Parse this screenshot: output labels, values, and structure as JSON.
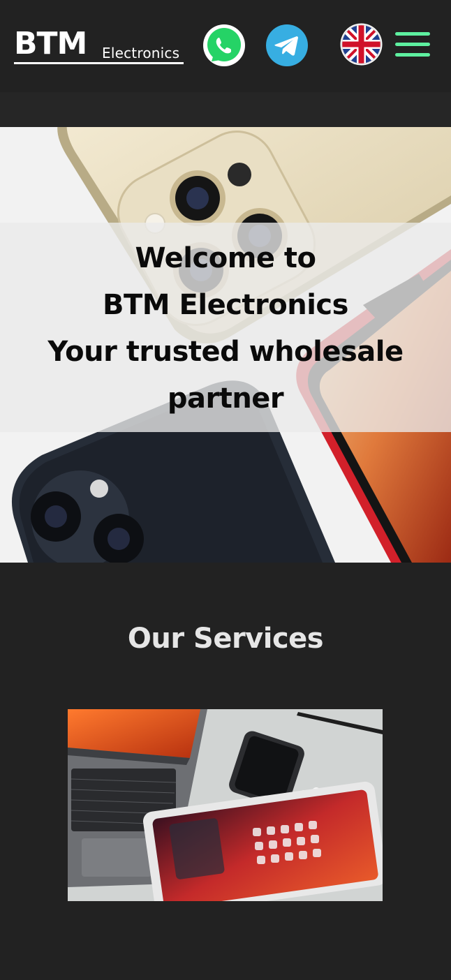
{
  "header": {
    "logo": {
      "mark": "BTM",
      "sub": "Electronics"
    },
    "whatsapp_icon": "whatsapp-icon",
    "telegram_icon": "telegram-icon",
    "language_icon": "uk-flag-icon",
    "menu_icon": "hamburger-menu-icon",
    "menu_color": "#5ef0a0"
  },
  "hero": {
    "lines": [
      "Welcome to",
      "BTM Electronics",
      "Your trusted wholesale",
      "partner"
    ]
  },
  "services": {
    "title": "Our Services",
    "image_icon": "devices-photo-icon"
  },
  "colors": {
    "background": "#222222",
    "accent": "#5ef0a0",
    "whatsapp": "#25d366",
    "telegram": "#37aee2"
  }
}
